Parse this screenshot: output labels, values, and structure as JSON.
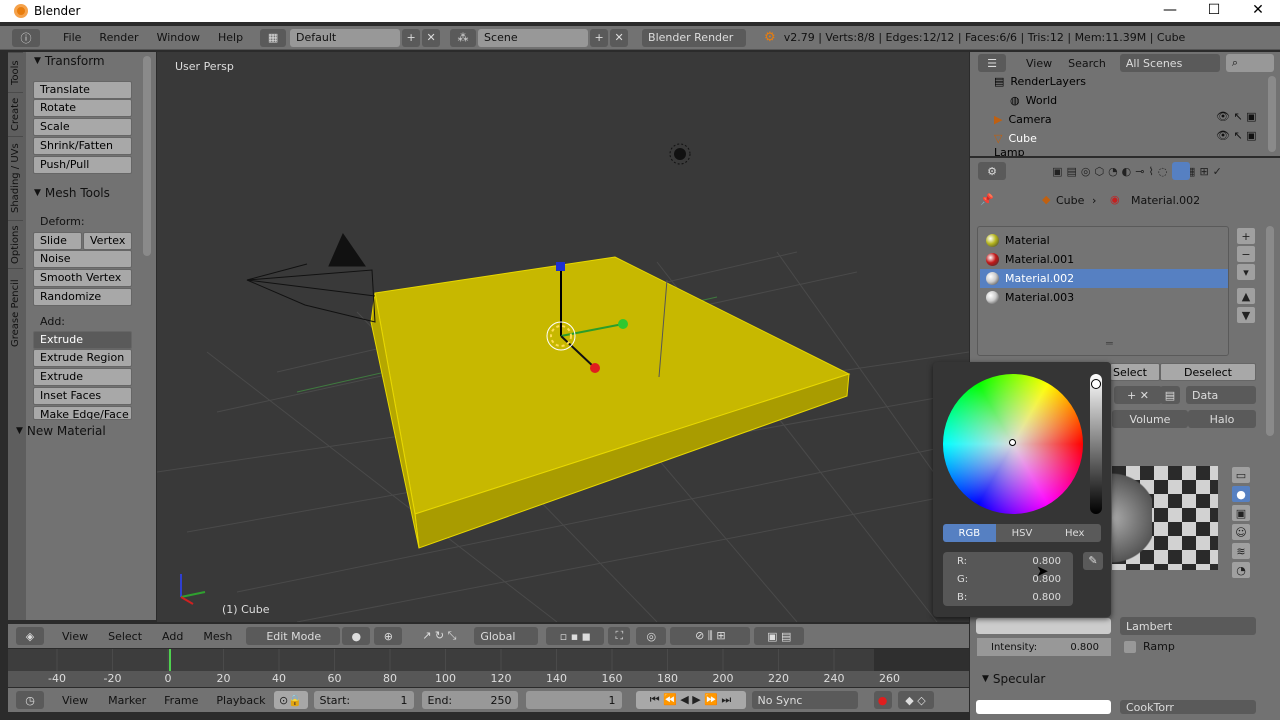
{
  "window": {
    "title": "Blender",
    "minimize": "—",
    "maximize": "☐",
    "close": "✕"
  },
  "info_header": {
    "menus": [
      "File",
      "Render",
      "Window",
      "Help"
    ],
    "layout": "Default",
    "scene": "Scene",
    "engine": "Blender Render",
    "stats": "v2.79 | Verts:8/8 | Edges:12/12 | Faces:6/6 | Tris:12 | Mem:11.39M | Cube"
  },
  "tool_shelf": {
    "tabs": [
      "Tools",
      "Create",
      "Shading / UVs",
      "Options",
      "Grease Pencil"
    ],
    "transform": {
      "title": "Transform",
      "buttons": [
        "Translate",
        "Rotate",
        "Scale",
        "Shrink/Fatten",
        "Push/Pull"
      ]
    },
    "mesh_tools": {
      "title": "Mesh Tools",
      "deform_label": "Deform:",
      "slide_edge": "Slide Ed",
      "vertex": "Vertex",
      "deform_buttons": [
        "Noise",
        "Smooth Vertex",
        "Randomize"
      ],
      "add_label": "Add:",
      "extrude": "Extrude",
      "add_buttons": [
        "Extrude Region",
        "Extrude Individual",
        "Inset Faces",
        "Make Edge/Face"
      ]
    },
    "new_material": "New Material"
  },
  "viewport": {
    "view_label": "User Persp",
    "object_label": "(1) Cube"
  },
  "view3d_header": {
    "menus": [
      "View",
      "Select",
      "Add",
      "Mesh"
    ],
    "mode": "Edit Mode",
    "orientation": "Global"
  },
  "timeline": {
    "ticks": [
      "-40",
      "-20",
      "0",
      "20",
      "40",
      "60",
      "80",
      "100",
      "120",
      "140",
      "160",
      "180",
      "200",
      "220",
      "240",
      "260"
    ],
    "current_frame_marker": 0
  },
  "timeline_header": {
    "menus": [
      "View",
      "Marker",
      "Frame",
      "Playback"
    ],
    "start_label": "Start:",
    "start_value": "1",
    "end_label": "End:",
    "end_value": "250",
    "current_frame": "1",
    "sync": "No Sync"
  },
  "outliner": {
    "menus": [
      "View",
      "Search"
    ],
    "scenes_dropdown": "All Scenes",
    "rows": [
      "RenderLayers",
      "World",
      "Camera",
      "Cube",
      "Lamp"
    ]
  },
  "properties": {
    "breadcrumb": {
      "object": "Cube",
      "material": "Material.002"
    },
    "materials": [
      {
        "name": "Material",
        "color": "#b5b51c"
      },
      {
        "name": "Material.001",
        "color": "#c21818"
      },
      {
        "name": "Material.002",
        "color": "#cccccc"
      },
      {
        "name": "Material.003",
        "color": "#cccccc"
      }
    ],
    "selected_material_index": 2,
    "select_btn": "Select",
    "deselect_btn": "Deselect",
    "data_dropdown": "Data",
    "volume_tab": "Volume",
    "halo_tab": "Halo",
    "diffuse_shader": "Lambert",
    "intensity_label": "Intensity:",
    "intensity_value": "0.800",
    "ramp_label": "Ramp",
    "specular_title": "Specular",
    "specular_shader": "CookTorr"
  },
  "color_picker": {
    "modes": [
      "RGB",
      "HSV",
      "Hex"
    ],
    "active_mode": "RGB",
    "r_label": "R:",
    "r_value": "0.800",
    "g_label": "G:",
    "g_value": "0.800",
    "b_label": "B:",
    "b_value": "0.800"
  },
  "colors": {
    "accent": "#5680c2",
    "mesh_face": "#c7b800",
    "panel_bg": "#727272"
  }
}
